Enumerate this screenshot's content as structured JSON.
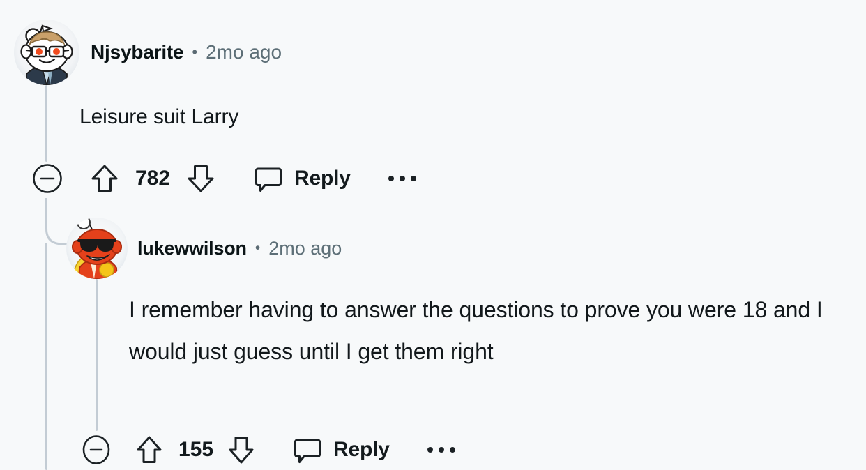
{
  "app": "reddit-comment-thread",
  "background_color": "#f7f9fa",
  "thread_line_color": "#c3ccd4",
  "comments": [
    {
      "id": "comment-1",
      "depth": 0,
      "author": "Njsybarite",
      "separator": "•",
      "timestamp": "2mo ago",
      "body": "Leisure suit Larry",
      "vote_count": "782",
      "reply_label": "Reply",
      "avatar": {
        "name": "snoo-avatar-njsybarite",
        "description": "reddit snoo wearing glasses and a navy suit",
        "skin": "#ffffff",
        "hair": "#c9a06a",
        "eyes": "#f04b1e",
        "suit": "#2c3a4a",
        "shirt": "#c6dbe8"
      },
      "actions": {
        "collapse": "collapse-thread",
        "upvote": "upvote",
        "downvote": "downvote",
        "reply": "reply",
        "more": "more-options"
      }
    },
    {
      "id": "comment-2",
      "depth": 1,
      "author": "lukewwilson",
      "separator": "•",
      "timestamp": "2mo ago",
      "body": "I remember having to answer the questions to prove you were 18 and I would just guess until I get them right",
      "vote_count": "155",
      "reply_label": "Reply",
      "avatar": {
        "name": "snoo-avatar-lukewwilson",
        "description": "orange reddit snoo with black sunglasses and yellow cape",
        "skin": "#e4411b",
        "shades": "#1a1a1a",
        "cape": "#f7d231",
        "emblem": "#f5c518",
        "mouth": "#ffffff"
      },
      "actions": {
        "collapse": "collapse-thread",
        "upvote": "upvote",
        "downvote": "downvote",
        "reply": "reply",
        "more": "more-options"
      }
    }
  ]
}
